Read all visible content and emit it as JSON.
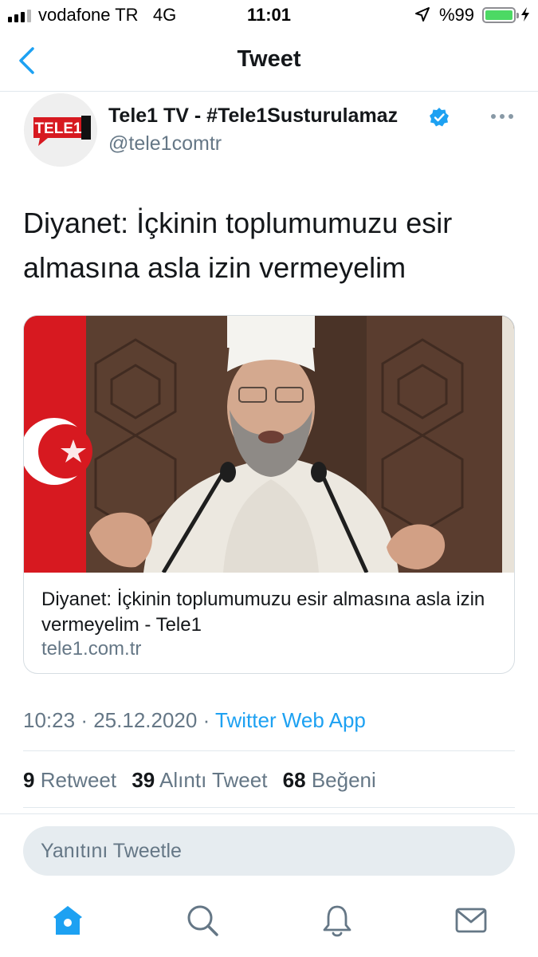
{
  "status": {
    "carrier": "vodafone TR",
    "network": "4G",
    "time": "11:01",
    "battery_pct": "%99",
    "battery_level": 0.99
  },
  "nav": {
    "title": "Tweet"
  },
  "tweet": {
    "author_name": "Tele1 TV - #Tele1Susturulamaz",
    "handle": "@tele1comtr",
    "avatar_text": "TELE1",
    "text": "Diyanet: İçkinin toplumumuzu esir almasına asla izin vermeyelim",
    "card": {
      "title": "Diyanet: İçkinin toplumumuzu esir almasına asla izin vermeyelim - Tele1",
      "domain": "tele1.com.tr"
    },
    "time": "10:23",
    "date": "25.12.2020",
    "separator": "·",
    "source": "Twitter Web App",
    "stats": {
      "retweets": "9",
      "retweets_label": "Retweet",
      "quotes": "39",
      "quotes_label": "Alıntı Tweet",
      "likes": "68",
      "likes_label": "Beğeni"
    }
  },
  "reply": {
    "placeholder": "Yanıtını Tweetle"
  },
  "tabs": [
    "home-icon",
    "search-icon",
    "notifications-icon",
    "messages-icon"
  ],
  "colors": {
    "accent": "#1da1f2",
    "secondary_text": "#657786",
    "battery": "#4cd964"
  }
}
